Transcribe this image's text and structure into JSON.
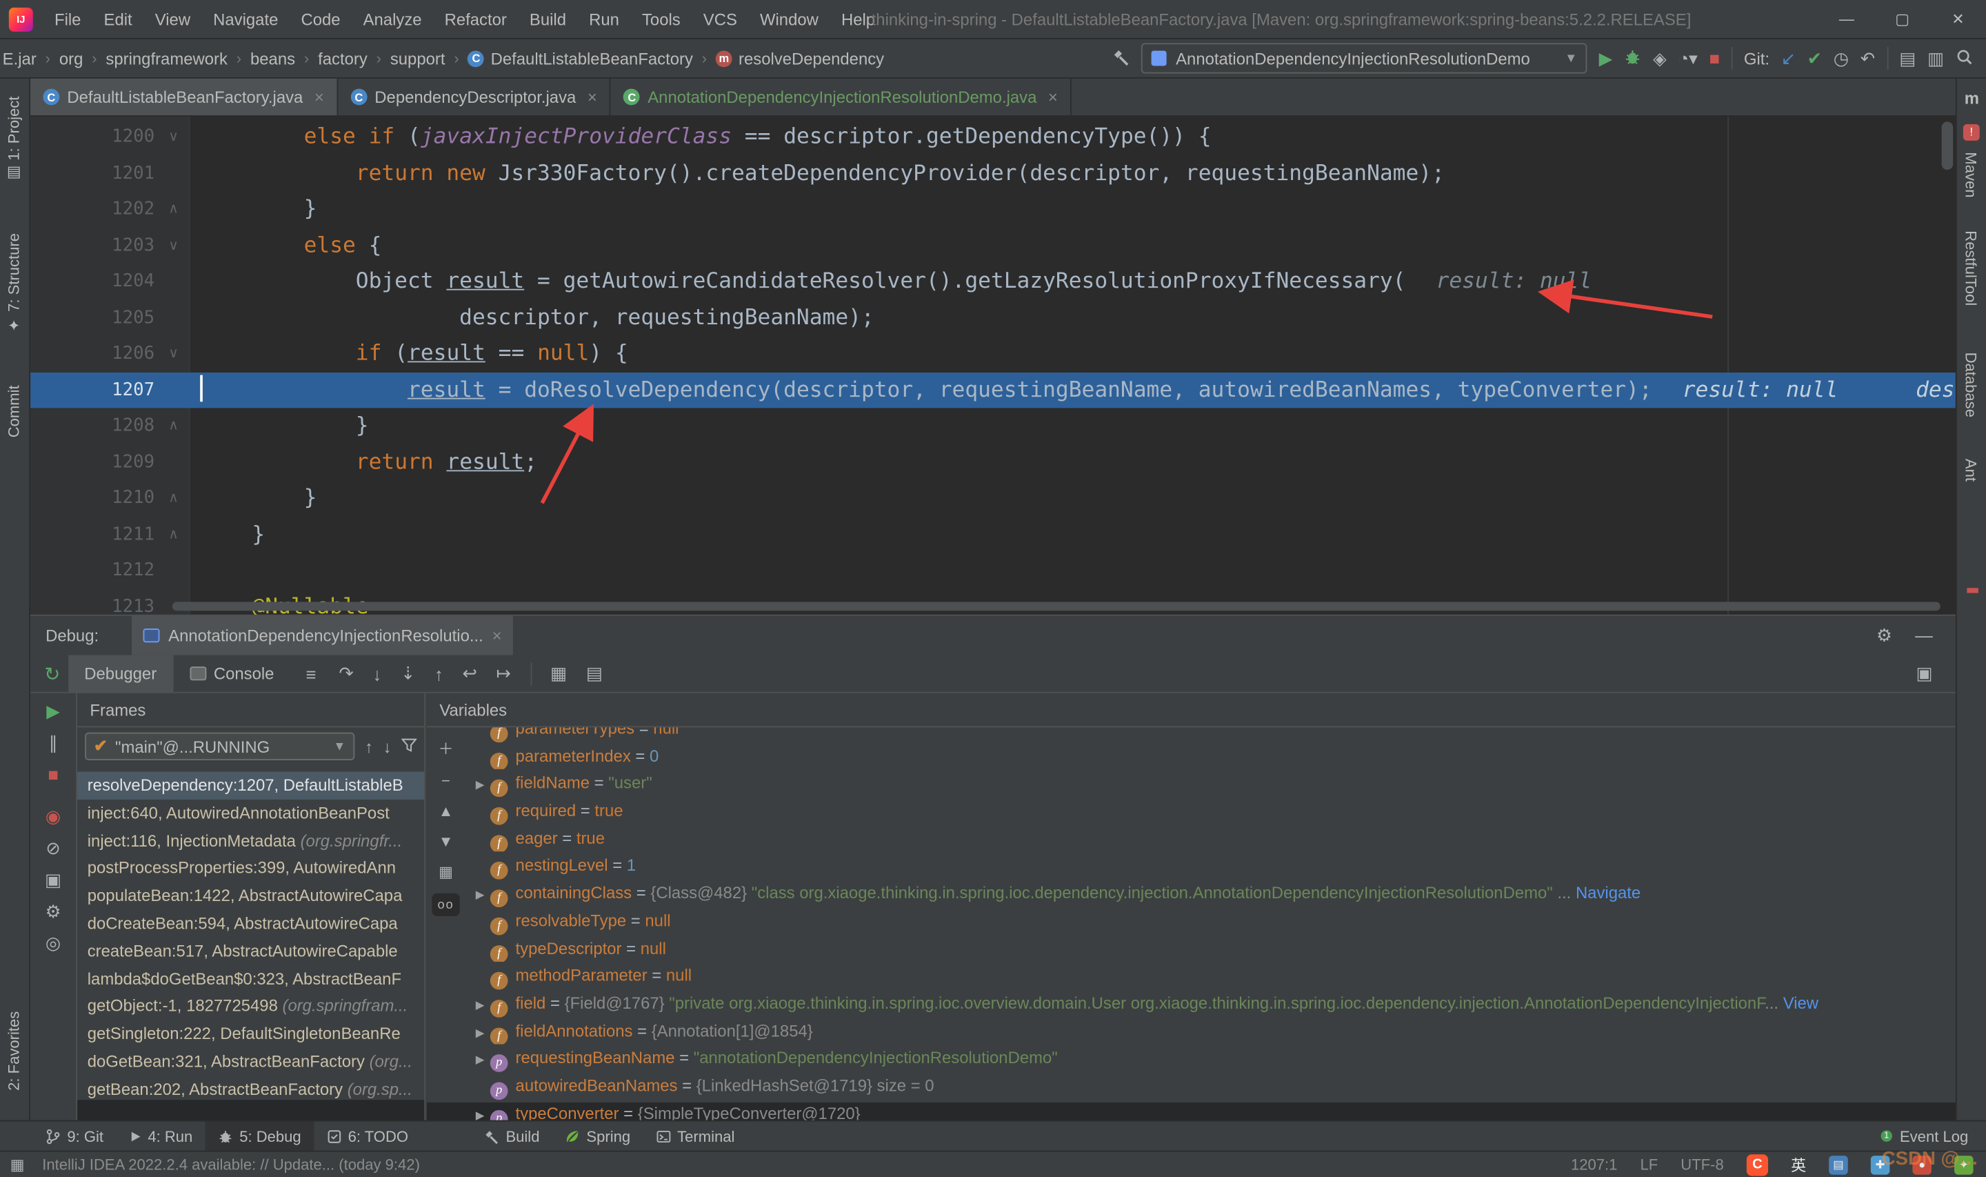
{
  "colors": {
    "execution_line": "#2D6099",
    "annotation_arrow": "#E8413C",
    "run_green": "#59A869",
    "stop_red": "#C75450",
    "link": "#5394EC",
    "string_green": "#6A8759",
    "selection": "#4C5A66"
  },
  "menubar": {
    "menus": [
      "File",
      "Edit",
      "View",
      "Navigate",
      "Code",
      "Analyze",
      "Refactor",
      "Build",
      "Run",
      "Tools",
      "VCS",
      "Window",
      "Help"
    ],
    "title": "thinking-in-spring - DefaultListableBeanFactory.java [Maven: org.springframework:spring-beans:5.2.2.RELEASE]"
  },
  "navbar": {
    "breadcrumbs": [
      {
        "label": "E.jar",
        "icon": ""
      },
      {
        "label": "org",
        "icon": ""
      },
      {
        "label": "springframework",
        "icon": ""
      },
      {
        "label": "beans",
        "icon": ""
      },
      {
        "label": "factory",
        "icon": ""
      },
      {
        "label": "support",
        "icon": ""
      },
      {
        "label": "DefaultListableBeanFactory",
        "icon": "class"
      },
      {
        "label": "resolveDependency",
        "icon": "method"
      }
    ],
    "run_config": "AnnotationDependencyInjectionResolutionDemo",
    "git_label": "Git:"
  },
  "editor_tabs": [
    {
      "label": "DefaultListableBeanFactory.java",
      "active": true,
      "green": false
    },
    {
      "label": "DependencyDescriptor.java",
      "active": false,
      "green": false
    },
    {
      "label": "AnnotationDependencyInjectionResolutionDemo.java",
      "active": false,
      "green": true
    }
  ],
  "left_stripe": {
    "items": [
      "1: Project",
      "7: Structure",
      "Commit",
      "2: Favorites"
    ]
  },
  "right_stripe": {
    "maven_letter": "m",
    "items": [
      "Maven",
      "RestfulTool",
      "Database",
      "Ant"
    ]
  },
  "editor": {
    "lines": [
      {
        "num": "1200",
        "fold": "v",
        "segs": [
          [
            "p",
            "        "
          ],
          [
            "k",
            "else if"
          ],
          [
            "p",
            " ("
          ],
          [
            "f",
            "javaxInjectProviderClass"
          ],
          [
            "p",
            " == descriptor.getDependencyType()) {"
          ]
        ]
      },
      {
        "num": "1201",
        "fold": "",
        "segs": [
          [
            "p",
            "            "
          ],
          [
            "k",
            "return new "
          ],
          [
            "p",
            "Jsr330Factory().createDependencyProvider(descriptor, requestingBeanName);"
          ]
        ]
      },
      {
        "num": "1202",
        "fold": "^",
        "segs": [
          [
            "p",
            "        }"
          ]
        ]
      },
      {
        "num": "1203",
        "fold": "v",
        "segs": [
          [
            "p",
            "        "
          ],
          [
            "k",
            "else"
          ],
          [
            "p",
            " {"
          ]
        ]
      },
      {
        "num": "1204",
        "fold": "",
        "segs": [
          [
            "p",
            "            Object "
          ],
          [
            "u",
            "result"
          ],
          [
            "p",
            " = getAutowireCandidateResolver().getLazyResolutionProxyIfNecessary("
          ]
        ],
        "hint": "result: null"
      },
      {
        "num": "1205",
        "fold": "",
        "segs": [
          [
            "p",
            "                    descriptor, requestingBeanName);"
          ]
        ]
      },
      {
        "num": "1206",
        "fold": "v",
        "segs": [
          [
            "p",
            "            "
          ],
          [
            "k",
            "if"
          ],
          [
            "p",
            " ("
          ],
          [
            "u",
            "result"
          ],
          [
            "p",
            " == "
          ],
          [
            "k",
            "null"
          ],
          [
            "p",
            ") {"
          ]
        ]
      },
      {
        "num": "1207",
        "fold": "",
        "current": true,
        "segs": [
          [
            "p",
            "                "
          ],
          [
            "u",
            "result"
          ],
          [
            "p",
            " = doResolveDependency(descriptor, requestingBeanName, autowiredBeanNames, typeConverter);"
          ]
        ],
        "hint": "result: null      descripto"
      },
      {
        "num": "1208",
        "fold": "^",
        "segs": [
          [
            "p",
            "            }"
          ]
        ]
      },
      {
        "num": "1209",
        "fold": "",
        "segs": [
          [
            "p",
            "            "
          ],
          [
            "k",
            "return"
          ],
          [
            "p",
            " "
          ],
          [
            "u",
            "result"
          ],
          [
            "p",
            ";"
          ]
        ]
      },
      {
        "num": "1210",
        "fold": "^",
        "segs": [
          [
            "p",
            "        }"
          ]
        ]
      },
      {
        "num": "1211",
        "fold": "^",
        "segs": [
          [
            "p",
            "    }"
          ]
        ]
      },
      {
        "num": "1212",
        "fold": "",
        "segs": []
      },
      {
        "num": "1213",
        "fold": "",
        "segs": [
          [
            "p",
            "    "
          ],
          [
            "a",
            "@Nullable"
          ]
        ]
      }
    ]
  },
  "debug": {
    "label": "Debug:",
    "session_tab": "AnnotationDependencyInjectionResolutio...",
    "tabs": [
      {
        "label": "Debugger",
        "active": true
      },
      {
        "label": "Console",
        "active": false
      }
    ],
    "frames": {
      "header": "Frames",
      "thread": "\"main\"@...RUNNING",
      "items": [
        {
          "main": "resolveDependency:1207, DefaultListableB",
          "sub": "",
          "selected": true
        },
        {
          "main": "inject:640, AutowiredAnnotationBeanPost",
          "sub": ""
        },
        {
          "main": "inject:116, InjectionMetadata ",
          "sub": "(org.springfr..."
        },
        {
          "main": "postProcessProperties:399, AutowiredAnn",
          "sub": ""
        },
        {
          "main": "populateBean:1422, AbstractAutowireCapa",
          "sub": ""
        },
        {
          "main": "doCreateBean:594, AbstractAutowireCapa",
          "sub": ""
        },
        {
          "main": "createBean:517, AbstractAutowireCapable",
          "sub": ""
        },
        {
          "main": "lambda$doGetBean$0:323, AbstractBeanF",
          "sub": ""
        },
        {
          "main": "getObject:-1, 1827725498 ",
          "sub": "(org.springfram..."
        },
        {
          "main": "getSingleton:222, DefaultSingletonBeanRe",
          "sub": ""
        },
        {
          "main": "doGetBean:321, AbstractBeanFactory ",
          "sub": "(org..."
        },
        {
          "main": "getBean:202, AbstractBeanFactory ",
          "sub": "(org.sp..."
        }
      ]
    },
    "variables": {
      "header": "Variables",
      "items": [
        {
          "partial": true,
          "expand": false,
          "icon": "f",
          "name": "parameterTypes",
          "segs": [
            [
              "eq",
              " = "
            ],
            [
              "kw",
              "null"
            ]
          ]
        },
        {
          "expand": false,
          "icon": "f",
          "name": "parameterIndex",
          "segs": [
            [
              "eq",
              " = "
            ],
            [
              "num",
              "0"
            ]
          ]
        },
        {
          "expand": true,
          "icon": "f",
          "name": "fieldName",
          "segs": [
            [
              "eq",
              " = "
            ],
            [
              "str",
              "\"user\""
            ]
          ]
        },
        {
          "expand": false,
          "icon": "f",
          "name": "required",
          "segs": [
            [
              "eq",
              " = "
            ],
            [
              "kw",
              "true"
            ]
          ]
        },
        {
          "expand": false,
          "icon": "f",
          "name": "eager",
          "segs": [
            [
              "eq",
              " = "
            ],
            [
              "kw",
              "true"
            ]
          ]
        },
        {
          "expand": false,
          "icon": "f",
          "name": "nestingLevel",
          "segs": [
            [
              "eq",
              " = "
            ],
            [
              "num",
              "1"
            ]
          ]
        },
        {
          "expand": true,
          "icon": "f",
          "name": "containingClass",
          "segs": [
            [
              "eq",
              " = "
            ],
            [
              "ref",
              "{Class@482} "
            ],
            [
              "str",
              "\"class org.xiaoge.thinking.in.spring.ioc.dependency.injection.AnnotationDependencyInjectionResolutionDemo\""
            ],
            [
              "dim",
              " ... "
            ],
            [
              "link",
              "Navigate"
            ]
          ]
        },
        {
          "expand": false,
          "icon": "f",
          "name": "resolvableType",
          "segs": [
            [
              "eq",
              " = "
            ],
            [
              "kw",
              "null"
            ]
          ]
        },
        {
          "expand": false,
          "icon": "f",
          "name": "typeDescriptor",
          "segs": [
            [
              "eq",
              " = "
            ],
            [
              "kw",
              "null"
            ]
          ]
        },
        {
          "expand": false,
          "icon": "f",
          "name": "methodParameter",
          "segs": [
            [
              "eq",
              " = "
            ],
            [
              "kw",
              "null"
            ]
          ]
        },
        {
          "expand": true,
          "icon": "f",
          "name": "field",
          "segs": [
            [
              "eq",
              " = "
            ],
            [
              "ref",
              "{Field@1767} "
            ],
            [
              "str",
              "\"private org.xiaoge.thinking.in.spring.ioc.overview.domain.User org.xiaoge.thinking.in.spring.ioc.dependency.injection.AnnotationDependencyInjectionF"
            ],
            [
              "dim",
              "... "
            ],
            [
              "link",
              "View"
            ]
          ]
        },
        {
          "expand": true,
          "icon": "f",
          "name": "fieldAnnotations",
          "segs": [
            [
              "eq",
              " = "
            ],
            [
              "ref",
              "{Annotation[1]@1854}"
            ]
          ]
        },
        {
          "expand": true,
          "icon": "p",
          "name": "requestingBeanName",
          "segs": [
            [
              "eq",
              " = "
            ],
            [
              "str",
              "\"annotationDependencyInjectionResolutionDemo\""
            ]
          ]
        },
        {
          "expand": false,
          "icon": "p",
          "name": "autowiredBeanNames",
          "segs": [
            [
              "eq",
              " = "
            ],
            [
              "ref",
              "{LinkedHashSet@1719} "
            ],
            [
              "dim",
              " size = 0"
            ]
          ]
        },
        {
          "expand": true,
          "icon": "p",
          "name": "typeConverter",
          "segs": [
            [
              "eq",
              " = "
            ],
            [
              "ref",
              "{SimpleTypeConverter@1720}"
            ]
          ]
        }
      ]
    }
  },
  "bottom_bar": {
    "left": [
      {
        "icon": "branch",
        "label": "9: Git",
        "active": false
      },
      {
        "icon": "play",
        "label": "4: Run",
        "active": false
      },
      {
        "icon": "bug",
        "label": "5: Debug",
        "active": true
      },
      {
        "icon": "todo",
        "label": "6: TODO",
        "active": false
      }
    ],
    "mid": [
      {
        "icon": "hammer",
        "label": "Build",
        "active": false
      },
      {
        "icon": "leaf",
        "label": "Spring",
        "active": false
      },
      {
        "icon": "terminal",
        "label": "Terminal",
        "active": false
      }
    ],
    "event_log": {
      "badge": "1",
      "label": "Event Log"
    }
  },
  "status_bar": {
    "message": "IntelliJ IDEA 2022.2.4 available: // Update... (today 9:42)",
    "caret_pos": "1207:1",
    "line_ending": "LF",
    "encoding": "UTF-8",
    "ime": "英",
    "watermark": "CSDN @…"
  }
}
